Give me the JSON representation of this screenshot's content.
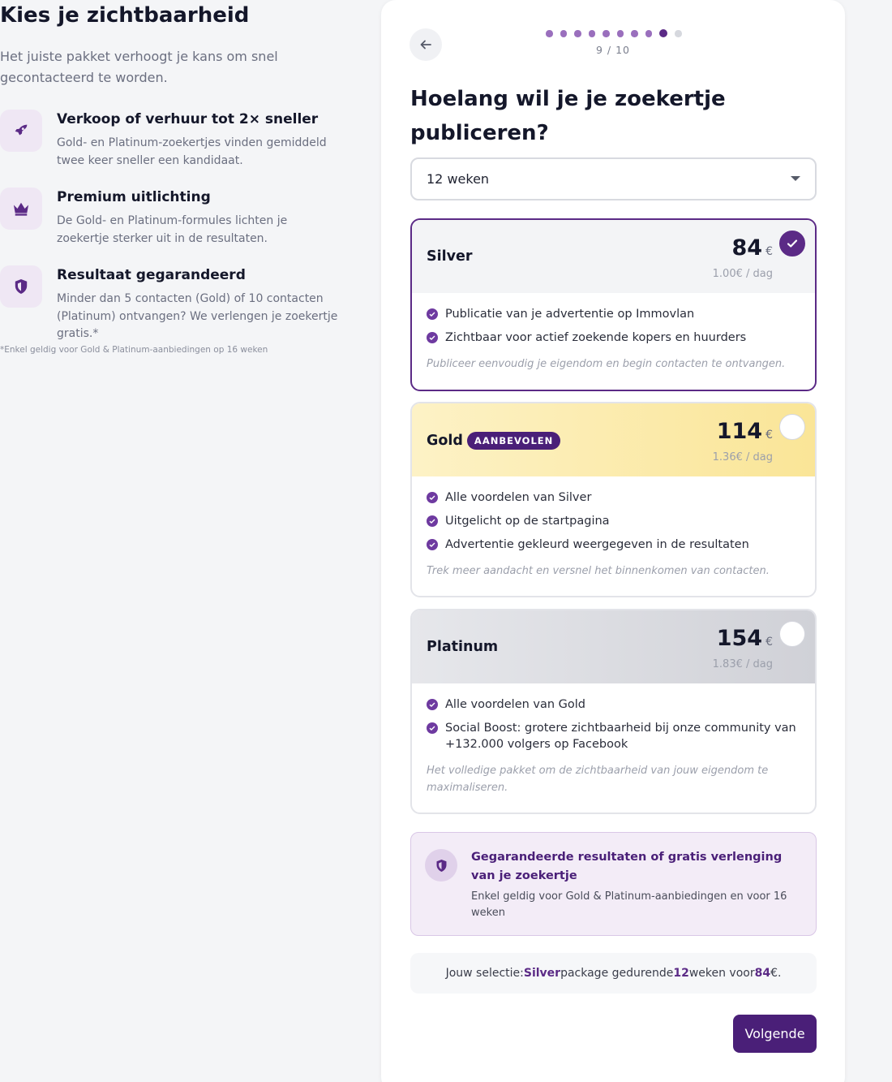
{
  "left": {
    "title": "Kies je zichtbaarheid",
    "intro": "Het juiste pakket verhoogt je kans om snel gecontacteerd te worden.",
    "features": [
      {
        "icon": "rocket-icon",
        "title": "Verkoop of verhuur tot 2× sneller",
        "desc": "Gold- en Platinum-zoekertjes vinden gemiddeld twee keer sneller een kandidaat."
      },
      {
        "icon": "crown-icon",
        "title": "Premium uitlichting",
        "desc": "De Gold- en Platinum-formules lichten je zoekertje sterker uit in de resultaten."
      },
      {
        "icon": "shield-icon",
        "title": "Resultaat gegarandeerd",
        "desc": "Minder dan 5 contacten (Gold) of 10 contacten (Platinum) ontvangen? We verlengen je zoekertje gratis.*"
      }
    ],
    "footnote": "*Enkel geldig voor Gold & Platinum-aanbiedingen op 16 weken"
  },
  "wizard": {
    "step_label": "9 / 10",
    "step_current": 9,
    "step_total": 10,
    "question": "Hoelang wil je je zoekertje publiceren?",
    "duration": {
      "value": "12 weken"
    }
  },
  "packages": [
    {
      "name": "Silver",
      "badge": "",
      "price": "84",
      "currency": "€",
      "per_day": "1.00€ / dag",
      "selected": true,
      "head_bg": "#f3f4f6",
      "features": [
        "Publicatie van je advertentie op Immovlan",
        "Zichtbaar voor actief zoekende kopers en huurders"
      ],
      "note": "Publiceer eenvoudig je eigendom en begin contacten te ontvangen."
    },
    {
      "name": "Gold",
      "badge": "AANBEVOLEN",
      "price": "114",
      "currency": "€",
      "per_day": "1.36€ / dag",
      "selected": false,
      "head_bg": "#fbecae",
      "features": [
        "Alle voordelen van Silver",
        "Uitgelicht op de startpagina",
        "Advertentie gekleurd weergegeven in de resultaten"
      ],
      "note": "Trek meer aandacht en versnel het binnenkomen van contacten."
    },
    {
      "name": "Platinum",
      "badge": "",
      "price": "154",
      "currency": "€",
      "per_day": "1.83€ / dag",
      "selected": false,
      "head_bg": "#dcdde2",
      "features": [
        "Alle voordelen van Gold",
        "Social Boost: grotere zichtbaarheid bij onze community van +132.000 volgers op Facebook"
      ],
      "note": "Het volledige pakket om de zichtbaarheid van jouw eigendom te maximaliseren."
    }
  ],
  "guarantee": {
    "title": "Gegarandeerde resultaten of gratis verlenging van je zoekertje",
    "desc": "Enkel geldig voor Gold & Platinum-aanbiedingen en voor 16 weken"
  },
  "summary": {
    "prefix": "Jouw selectie: ",
    "package": "Silver",
    "mid1": " package gedurende ",
    "weeks": "12",
    "mid2": " weken voor ",
    "price": "84",
    "suffix": " €."
  },
  "buttons": {
    "next_label": "Volgende"
  },
  "colors": {
    "accent": "#5b2a86",
    "accent_dark": "#4a1f78",
    "gold_head": "#fbecae",
    "platinum_head": "#dcdde2"
  }
}
